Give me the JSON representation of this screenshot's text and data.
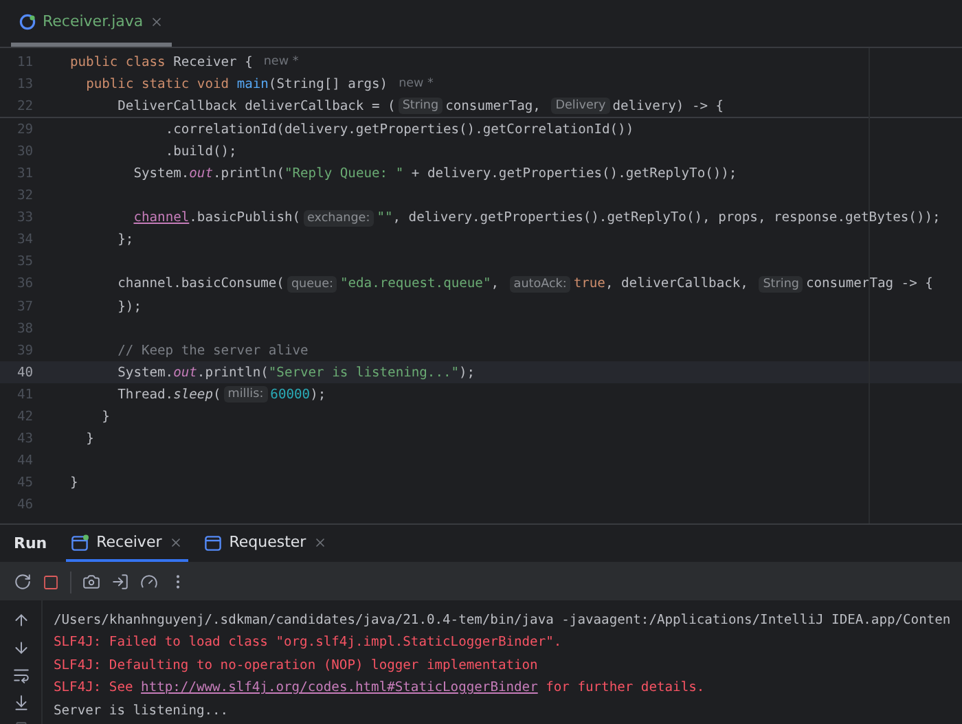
{
  "editor_tabs": [
    {
      "label": "Receiver.java",
      "selected": true
    }
  ],
  "sticky_lines": [
    {
      "number": "11",
      "current": false,
      "tokens": [
        {
          "kind": "kw",
          "text": "public class "
        },
        {
          "kind": "plain",
          "text": "Receiver {"
        },
        {
          "kind": "author",
          "text": "new *"
        }
      ]
    },
    {
      "number": "13",
      "current": false,
      "tokens": [
        {
          "kind": "kw",
          "text": "  public static void "
        },
        {
          "kind": "fn",
          "text": "main"
        },
        {
          "kind": "plain",
          "text": "(String[] args)"
        },
        {
          "kind": "author",
          "text": "new *"
        }
      ]
    },
    {
      "number": "22",
      "current": false,
      "tokens": [
        {
          "kind": "plain",
          "text": "      DeliverCallback deliverCallback = ("
        },
        {
          "kind": "hint",
          "text": "String"
        },
        {
          "kind": "plain",
          "text": "consumerTag, "
        },
        {
          "kind": "hint",
          "text": "Delivery"
        },
        {
          "kind": "plain",
          "text": "delivery) -> {"
        }
      ]
    }
  ],
  "lines": [
    {
      "number": "29",
      "current": false,
      "tokens": [
        {
          "kind": "plain",
          "text": "            .correlationId(delivery.getProperties().getCorrelationId())"
        }
      ]
    },
    {
      "number": "30",
      "current": false,
      "tokens": [
        {
          "kind": "plain",
          "text": "            .build();"
        }
      ]
    },
    {
      "number": "31",
      "current": false,
      "tokens": [
        {
          "kind": "plain",
          "text": "        System."
        },
        {
          "kind": "field",
          "text": "out"
        },
        {
          "kind": "plain",
          "text": ".println("
        },
        {
          "kind": "str",
          "text": "\"Reply Queue: \""
        },
        {
          "kind": "plain",
          "text": " + delivery.getProperties().getReplyTo());"
        }
      ]
    },
    {
      "number": "32",
      "current": false
    },
    {
      "number": "33",
      "current": false,
      "tokens": [
        {
          "kind": "link",
          "text": "        channel"
        },
        {
          "kind": "plain",
          "text": ".basicPublish("
        },
        {
          "kind": "hint",
          "text": "exchange:"
        },
        {
          "kind": "str",
          "text": "\"\""
        },
        {
          "kind": "plain",
          "text": ", delivery.getProperties().getReplyTo(), props, response.getBytes());"
        }
      ]
    },
    {
      "number": "34",
      "current": false,
      "tokens": [
        {
          "kind": "plain",
          "text": "      };"
        }
      ]
    },
    {
      "number": "35",
      "current": false
    },
    {
      "number": "36",
      "current": false,
      "tokens": [
        {
          "kind": "plain",
          "text": "      channel.basicConsume("
        },
        {
          "kind": "hint",
          "text": "queue:"
        },
        {
          "kind": "str",
          "text": "\"eda.request.queue\""
        },
        {
          "kind": "plain",
          "text": ", "
        },
        {
          "kind": "hint",
          "text": "autoAck:"
        },
        {
          "kind": "kw",
          "text": "true"
        },
        {
          "kind": "plain",
          "text": ", deliverCallback, "
        },
        {
          "kind": "hint",
          "text": "String"
        },
        {
          "kind": "plain",
          "text": "consumerTag -> {"
        }
      ]
    },
    {
      "number": "37",
      "current": false,
      "tokens": [
        {
          "kind": "plain",
          "text": "      });"
        }
      ]
    },
    {
      "number": "38",
      "current": false
    },
    {
      "number": "39",
      "current": false,
      "tokens": [
        {
          "kind": "comment",
          "text": "      // Keep the server alive"
        }
      ]
    },
    {
      "number": "40",
      "current": true,
      "tokens": [
        {
          "kind": "plain",
          "text": "      System."
        },
        {
          "kind": "field",
          "text": "out"
        },
        {
          "kind": "plain",
          "text": ".println("
        },
        {
          "kind": "str",
          "text": "\"Server is listening...\""
        },
        {
          "kind": "plain",
          "text": ");"
        }
      ]
    },
    {
      "number": "41",
      "current": false,
      "tokens": [
        {
          "kind": "plain",
          "text": "      Thread."
        },
        {
          "kind": "italic",
          "text": "sleep"
        },
        {
          "kind": "plain",
          "text": "("
        },
        {
          "kind": "hint",
          "text": "millis:"
        },
        {
          "kind": "num",
          "text": "60000"
        },
        {
          "kind": "plain",
          "text": ");"
        }
      ]
    },
    {
      "number": "42",
      "current": false,
      "tokens": [
        {
          "kind": "plain",
          "text": "    }"
        }
      ]
    },
    {
      "number": "43",
      "current": false,
      "tokens": [
        {
          "kind": "plain",
          "text": "  }"
        }
      ]
    },
    {
      "number": "44",
      "current": false
    },
    {
      "number": "45",
      "current": false,
      "tokens": [
        {
          "kind": "plain",
          "text": "}"
        }
      ]
    },
    {
      "number": "46",
      "current": false
    }
  ],
  "run_panel": {
    "title": "Run",
    "tabs": [
      {
        "label": "Receiver",
        "selected": true,
        "running": true
      },
      {
        "label": "Requester",
        "selected": false,
        "running": false
      }
    ],
    "console": [
      {
        "tokens": [
          {
            "kind": "plain",
            "text": "/Users/khanhnguyenj/.sdkman/candidates/java/21.0.4-tem/bin/java -javaagent:/Applications/IntelliJ IDEA.app/Conten"
          }
        ]
      },
      {
        "tokens": [
          {
            "kind": "error",
            "text": "SLF4J: Failed to load class \"org.slf4j.impl.StaticLoggerBinder\"."
          }
        ]
      },
      {
        "tokens": [
          {
            "kind": "error",
            "text": "SLF4J: Defaulting to no-operation (NOP) logger implementation"
          }
        ]
      },
      {
        "tokens": [
          {
            "kind": "error",
            "text": "SLF4J: See "
          },
          {
            "kind": "link",
            "text": "http://www.slf4j.org/codes.html#StaticLoggerBinder"
          },
          {
            "kind": "error",
            "text": " for further details."
          }
        ]
      },
      {
        "tokens": [
          {
            "kind": "plain",
            "text": "Server is listening..."
          }
        ]
      }
    ]
  }
}
